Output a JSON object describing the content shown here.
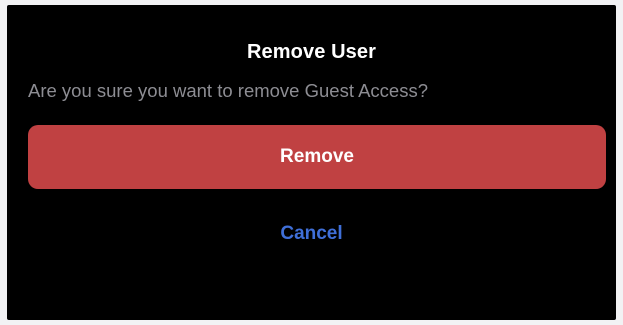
{
  "dialog": {
    "title": "Remove User",
    "message": "Are you sure you want to remove Guest Access?",
    "remove_label": "Remove",
    "cancel_label": "Cancel"
  },
  "colors": {
    "background": "#000000",
    "destructive": "#c04142",
    "link": "#3f6fd8",
    "secondary_text": "#8d8d93"
  }
}
